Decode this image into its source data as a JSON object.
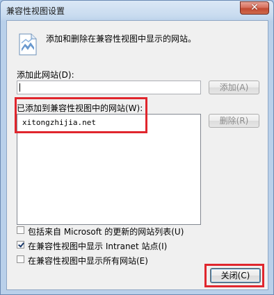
{
  "window": {
    "title": "兼容性视图设置",
    "close_glyph": "✕"
  },
  "description": "添加和删除在兼容性视图中显示的网站。",
  "add_site": {
    "label": "添加此网站(D):",
    "input_value": "",
    "button_label": "添加(A)"
  },
  "added_sites": {
    "label": "已添加到兼容性视图中的网站(W):",
    "items": [
      "xitongzhijia.net"
    ],
    "remove_label": "删除(R)"
  },
  "options": [
    {
      "label": "包括来自 Microsoft 的更新的网站列表(U)",
      "checked": false
    },
    {
      "label": "在兼容性视图中显示 Intranet 站点(I)",
      "checked": true
    },
    {
      "label": "在兼容性视图中显示所有网站(E)",
      "checked": false
    }
  ],
  "close_button_label": "关闭(C)",
  "colors": {
    "highlight": "#e0262d",
    "titlebar_close": "#c24a32"
  },
  "icons": {
    "document": "document-icon"
  }
}
